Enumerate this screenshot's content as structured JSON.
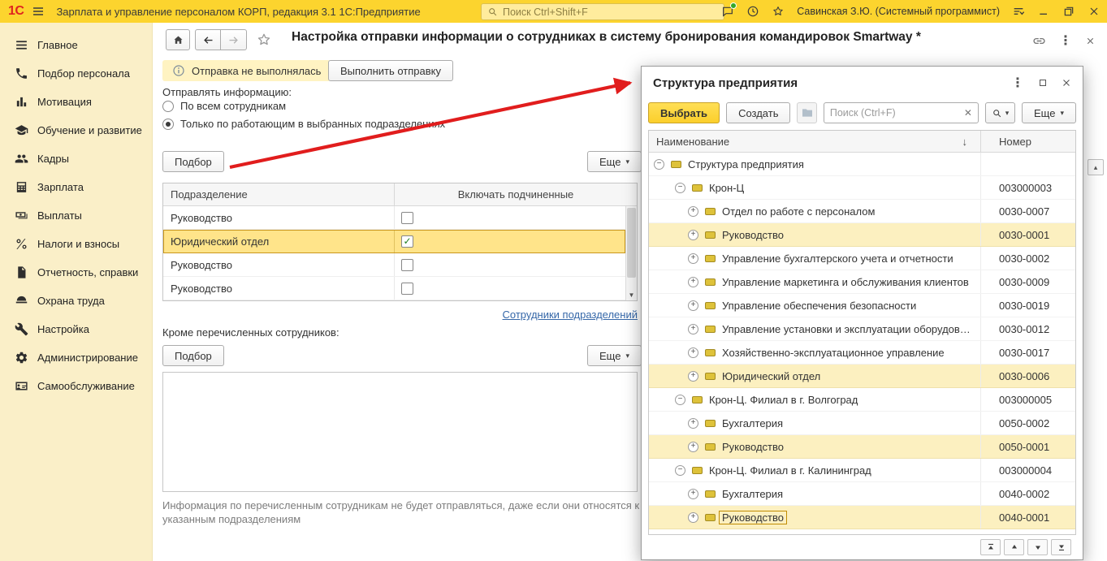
{
  "colors": {
    "brand-yellow": "#fcd42e",
    "sidebar-bg": "#faefc8",
    "selection": "#ffe48a",
    "selection-border": "#c9971c",
    "highlight": "#fcf0c0",
    "link": "#3567a8",
    "badge-bg": "#fff3c2",
    "arrow-red": "#e11d1d"
  },
  "titlebar": {
    "logo": "1С",
    "app_title": "Зарплата и управление персоналом КОРП, редакция 3.1 1С:Предприятие",
    "search_placeholder": "Поиск Ctrl+Shift+F",
    "user": "Савинская З.Ю. (Системный программист)"
  },
  "sidebar": {
    "items": [
      {
        "id": "glavnoe",
        "icon": "menu-icon",
        "label": "Главное"
      },
      {
        "id": "podbor-personala",
        "icon": "phone-icon",
        "label": "Подбор персонала"
      },
      {
        "id": "motivatsiya",
        "icon": "chart-icon",
        "label": "Мотивация"
      },
      {
        "id": "obuchenie-i-razvitie",
        "icon": "education-icon",
        "label": "Обучение и развитие"
      },
      {
        "id": "kadry",
        "icon": "people-icon",
        "label": "Кадры"
      },
      {
        "id": "zarplata",
        "icon": "calculator-icon",
        "label": "Зарплата"
      },
      {
        "id": "vyplaty",
        "icon": "payments-icon",
        "label": "Выплаты"
      },
      {
        "id": "nalogi-i-vznosy",
        "icon": "percent-icon",
        "label": "Налоги и взносы"
      },
      {
        "id": "otchetnost-spravki",
        "icon": "report-icon",
        "label": "Отчетность, справки"
      },
      {
        "id": "ohrana-truda",
        "icon": "helmet-icon",
        "label": "Охрана труда"
      },
      {
        "id": "nastroyka",
        "icon": "wrench-icon",
        "label": "Настройка"
      },
      {
        "id": "administrirovanie",
        "icon": "gear-icon",
        "label": "Администрирование"
      },
      {
        "id": "samoobsluzhivanie",
        "icon": "idcard-icon",
        "label": "Самообслуживание"
      }
    ]
  },
  "main": {
    "title": "Настройка отправки информации о сотрудниках в систему бронирования командировок Smartway *",
    "status_badge": "Отправка не выполнялась",
    "send_button": "Выполнить отправку",
    "send_info_label": "Отправлять информацию:",
    "radio_options": [
      {
        "label": "По всем сотрудникам",
        "selected": false
      },
      {
        "label": "Только по работающим в выбранных подразделениях",
        "selected": true
      }
    ],
    "pick_button": "Подбор",
    "more_button": "Еще",
    "table": {
      "columns": [
        "Подразделение",
        "Включать подчиненные"
      ],
      "rows": [
        {
          "name": "Руководство",
          "checked": false,
          "selected": false
        },
        {
          "name": "Юридический отдел",
          "checked": true,
          "selected": true
        },
        {
          "name": "Руководство",
          "checked": false,
          "selected": false
        },
        {
          "name": "Руководство",
          "checked": false,
          "selected": false
        }
      ]
    },
    "employees_link": "Сотрудники подразделений",
    "except_label": "Кроме перечисленных сотрудников:",
    "footnote": "Информация по перечисленным сотрудникам не будет отправляться, даже если они относятся к указанным подразделениям"
  },
  "dialog": {
    "title": "Структура предприятия",
    "select_button": "Выбрать",
    "create_button": "Создать",
    "search_placeholder": "Поиск (Ctrl+F)",
    "more_button": "Еще",
    "columns": [
      "Наименование",
      "Номер"
    ],
    "sort_indicator": "↓",
    "rows": [
      {
        "name": "Структура предприятия",
        "number": "",
        "level": 0,
        "expanded": true,
        "highlight": false,
        "focused": false
      },
      {
        "name": "Крон-Ц",
        "number": "003000003",
        "level": 1,
        "expanded": true,
        "highlight": false,
        "focused": false
      },
      {
        "name": "Отдел по работе с персоналом",
        "number": "0030-0007",
        "level": 2,
        "expanded": false,
        "highlight": false,
        "focused": false
      },
      {
        "name": "Руководство",
        "number": "0030-0001",
        "level": 2,
        "expanded": false,
        "highlight": true,
        "focused": false
      },
      {
        "name": "Управление бухгалтерского учета и отчетности",
        "number": "0030-0002",
        "level": 2,
        "expanded": false,
        "highlight": false,
        "focused": false
      },
      {
        "name": "Управление маркетинга и обслуживания клиентов",
        "number": "0030-0009",
        "level": 2,
        "expanded": false,
        "highlight": false,
        "focused": false
      },
      {
        "name": "Управление обеспечения безопасности",
        "number": "0030-0019",
        "level": 2,
        "expanded": false,
        "highlight": false,
        "focused": false
      },
      {
        "name": "Управление установки и эксплуатации оборудов…",
        "number": "0030-0012",
        "level": 2,
        "expanded": false,
        "highlight": false,
        "focused": false
      },
      {
        "name": "Хозяйственно-эксплуатационное управление",
        "number": "0030-0017",
        "level": 2,
        "expanded": false,
        "highlight": false,
        "focused": false
      },
      {
        "name": "Юридический отдел",
        "number": "0030-0006",
        "level": 2,
        "expanded": false,
        "highlight": true,
        "focused": false
      },
      {
        "name": "Крон-Ц. Филиал в г. Волгоград",
        "number": "003000005",
        "level": 1,
        "expanded": true,
        "highlight": false,
        "focused": false
      },
      {
        "name": "Бухгалтерия",
        "number": "0050-0002",
        "level": 2,
        "expanded": false,
        "highlight": false,
        "focused": false
      },
      {
        "name": "Руководство",
        "number": "0050-0001",
        "level": 2,
        "expanded": false,
        "highlight": true,
        "focused": false
      },
      {
        "name": "Крон-Ц. Филиал в г. Калининград",
        "number": "003000004",
        "level": 1,
        "expanded": true,
        "highlight": false,
        "focused": false
      },
      {
        "name": "Бухгалтерия",
        "number": "0040-0002",
        "level": 2,
        "expanded": false,
        "highlight": false,
        "focused": false
      },
      {
        "name": "Руководство",
        "number": "0040-0001",
        "level": 2,
        "expanded": false,
        "highlight": true,
        "focused": true
      }
    ]
  }
}
